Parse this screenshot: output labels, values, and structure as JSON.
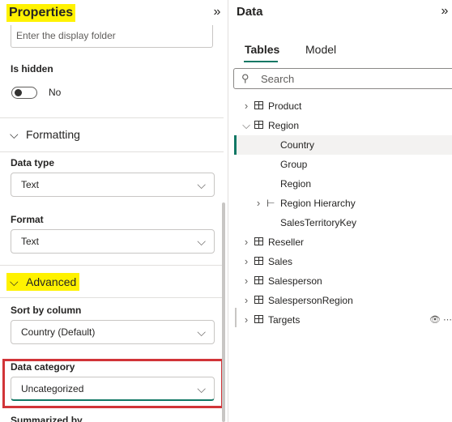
{
  "properties": {
    "title": "Properties",
    "collapse_icon": "»",
    "display_folder_placeholder": "Enter the display folder",
    "is_hidden_label": "Is hidden",
    "is_hidden_value": "No",
    "formatting_section": "Formatting",
    "data_type_label": "Data type",
    "data_type_value": "Text",
    "format_label": "Format",
    "format_value": "Text",
    "advanced_section": "Advanced",
    "sort_by_label": "Sort by column",
    "sort_by_value": "Country (Default)",
    "data_category_label": "Data category",
    "data_category_value": "Uncategorized",
    "summarize_label_partial": "Summarized by"
  },
  "data_pane": {
    "title": "Data",
    "collapse_icon": "»",
    "tabs": [
      {
        "label": "Tables",
        "selected": true
      },
      {
        "label": "Model",
        "selected": false
      }
    ],
    "search_placeholder": "Search",
    "tree": [
      {
        "label": "Product",
        "type": "table",
        "expanded": false
      },
      {
        "label": "Region",
        "type": "table",
        "expanded": true
      },
      {
        "label": "Country",
        "type": "column",
        "selected": true
      },
      {
        "label": "Group",
        "type": "column"
      },
      {
        "label": "Region",
        "type": "column"
      },
      {
        "label": "Region Hierarchy",
        "type": "hierarchy",
        "expanded": false
      },
      {
        "label": "SalesTerritoryKey",
        "type": "column"
      },
      {
        "label": "Reseller",
        "type": "table",
        "expanded": false
      },
      {
        "label": "Sales",
        "type": "table",
        "expanded": false
      },
      {
        "label": "Salesperson",
        "type": "table",
        "expanded": false
      },
      {
        "label": "SalespersonRegion",
        "type": "table",
        "expanded": false
      },
      {
        "label": "Targets",
        "type": "table",
        "expanded": false,
        "actions": "👁 ⋯"
      }
    ]
  },
  "colors": {
    "accent": "#117865",
    "highlight": "#fff200",
    "focus_box": "#d13438"
  }
}
